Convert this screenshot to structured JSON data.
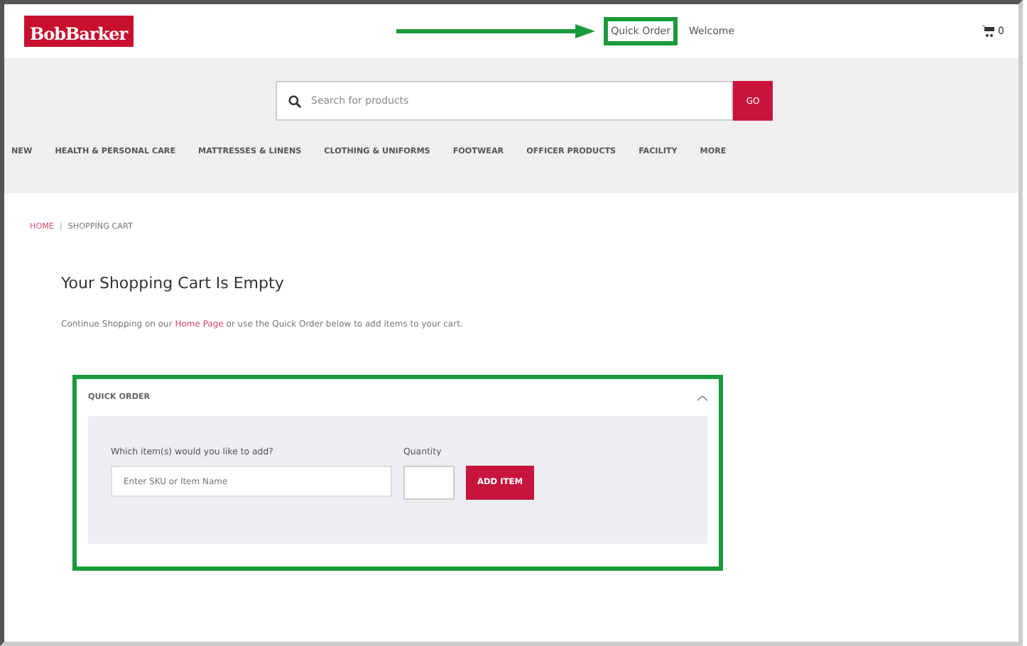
{
  "header": {
    "logo": "BobBarker",
    "links": [
      {
        "label": "Quick Order",
        "highlighted": true
      },
      {
        "label": "Welcome",
        "highlighted": false
      }
    ],
    "cart_count": "0"
  },
  "search": {
    "placeholder": "Search for products",
    "button": "GO"
  },
  "nav": [
    "NEW",
    "HEALTH & PERSONAL CARE",
    "MATTRESSES & LINENS",
    "CLOTHING & UNIFORMS",
    "FOOTWEAR",
    "OFFICER PRODUCTS",
    "FACILITY",
    "MORE"
  ],
  "breadcrumb": [
    {
      "label": "HOME",
      "link": true
    },
    {
      "label": "SHOPPING CART",
      "link": false
    }
  ],
  "breadcrumb_separator": "|",
  "title": "Your Shopping Cart Is Empty",
  "message": {
    "before": "Continue Shopping on our",
    "link": "Home Page",
    "after": "or use the Quick Order below to add items to your cart."
  },
  "quick_order": {
    "title": "QUICK ORDER",
    "expanded": true,
    "item_label": "Which item(s) would you like to add?",
    "item_placeholder": "Enter SKU or Item Name",
    "quantity_label": "Quantity",
    "button": "ADD ITEM"
  }
}
